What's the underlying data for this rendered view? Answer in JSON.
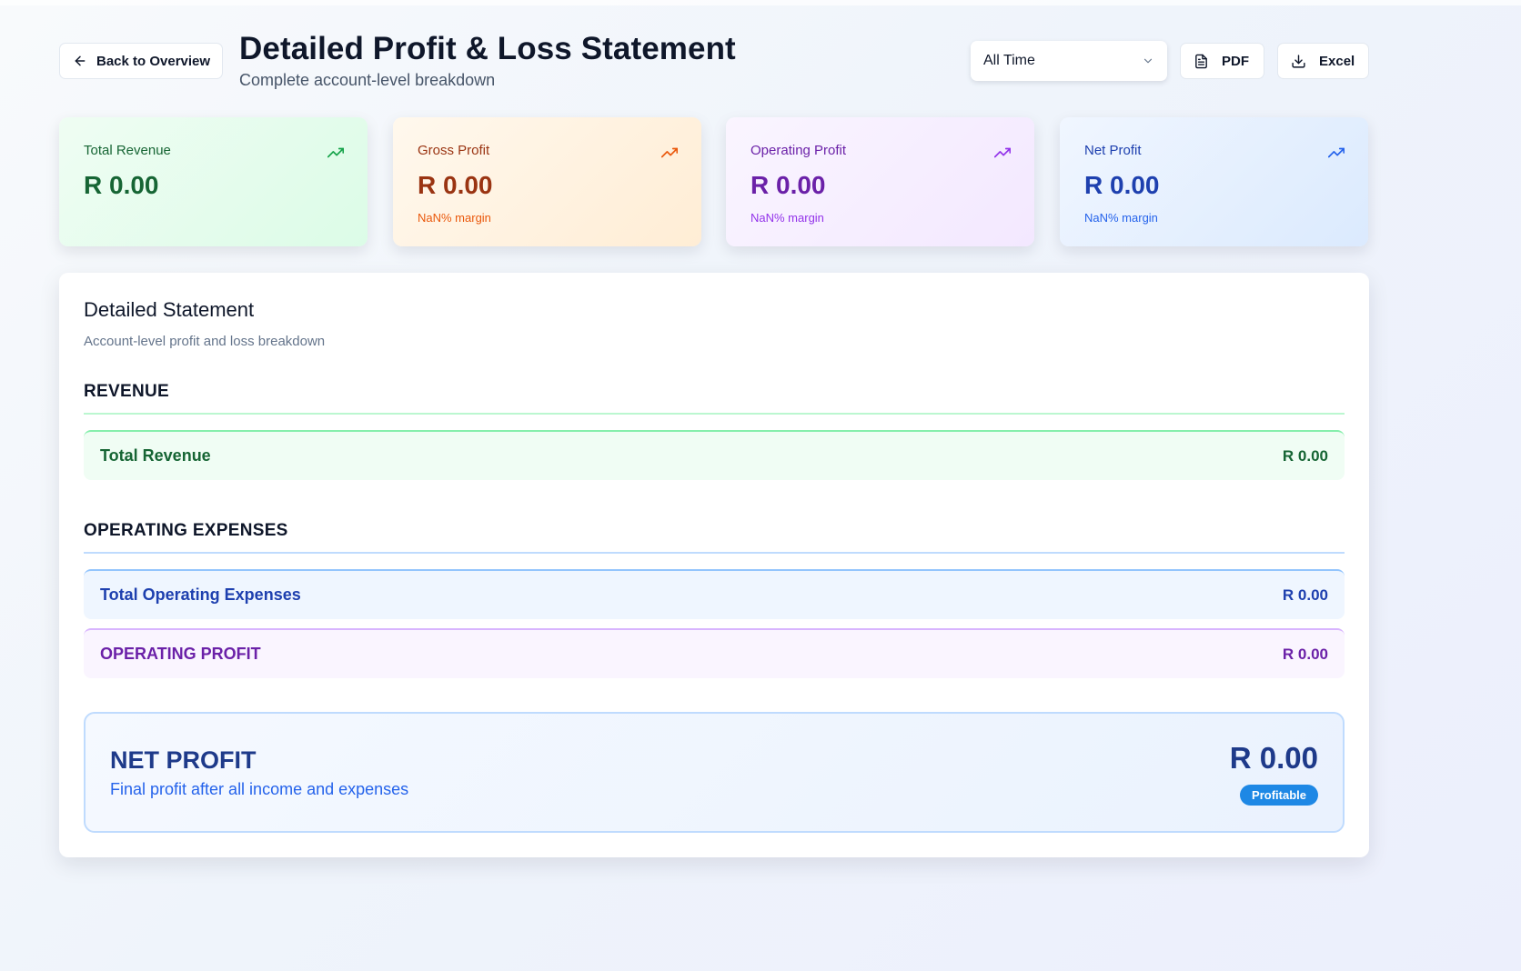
{
  "header": {
    "back_label": "Back to Overview",
    "title": "Detailed Profit & Loss Statement",
    "subtitle": "Complete account-level breakdown",
    "period_selected": "All Time",
    "pdf_label": "PDF",
    "excel_label": "Excel"
  },
  "cards": {
    "revenue": {
      "label": "Total Revenue",
      "value": "R 0.00"
    },
    "gross": {
      "label": "Gross Profit",
      "value": "R 0.00",
      "sub": "NaN% margin"
    },
    "operating": {
      "label": "Operating Profit",
      "value": "R 0.00",
      "sub": "NaN% margin"
    },
    "net": {
      "label": "Net Profit",
      "value": "R 0.00",
      "sub": "NaN% margin"
    }
  },
  "statement": {
    "title": "Detailed Statement",
    "description": "Account-level profit and loss breakdown",
    "revenue_section": {
      "heading": "REVENUE",
      "total_label": "Total Revenue",
      "total_value": "R 0.00"
    },
    "opex_section": {
      "heading": "OPERATING EXPENSES",
      "total_label": "Total Operating Expenses",
      "total_value": "R 0.00",
      "operating_profit_label": "OPERATING PROFIT",
      "operating_profit_value": "R 0.00"
    },
    "net_profit": {
      "title": "NET PROFIT",
      "description": "Final profit after all income and expenses",
      "value": "R 0.00",
      "badge": "Profitable"
    }
  },
  "icons": {
    "back": "arrow-left-icon",
    "dropdown": "chevron-down-icon",
    "pdf": "file-text-icon",
    "excel": "download-icon",
    "trend": "trending-up-icon"
  },
  "colors": {
    "revenue": "#166534",
    "gross": "#9a3412",
    "operating": "#6b21a8",
    "net": "#1e40af",
    "badge": "#1e88e5"
  }
}
